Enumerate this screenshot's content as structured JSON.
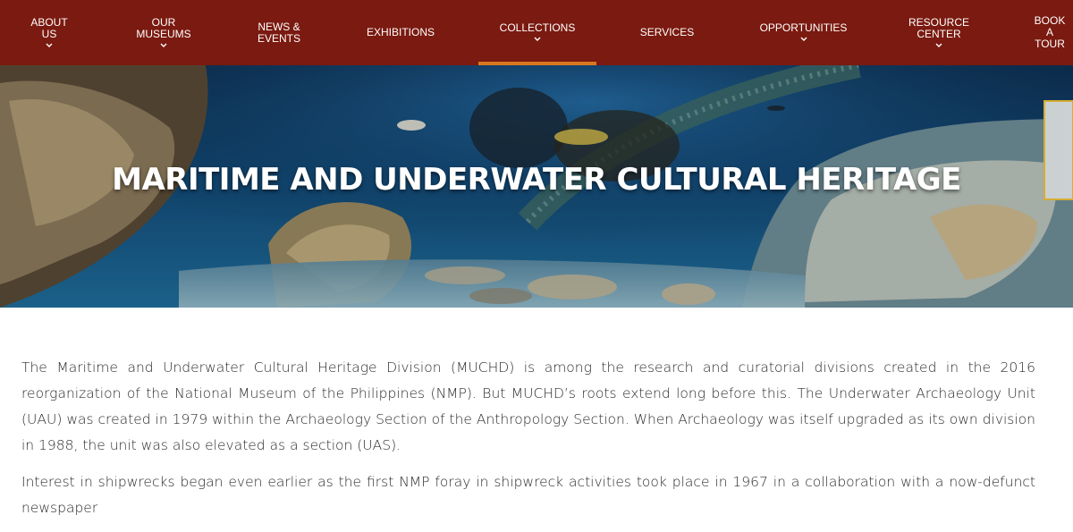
{
  "nav": {
    "items": [
      {
        "label": "ABOUT\nUS",
        "has_dropdown": true
      },
      {
        "label": "OUR\nMUSEUMS",
        "has_dropdown": true
      },
      {
        "label": "NEWS &\nEVENTS",
        "has_dropdown": false
      },
      {
        "label": "EXHIBITIONS",
        "has_dropdown": false
      },
      {
        "label": "COLLECTIONS",
        "has_dropdown": true,
        "active": true
      },
      {
        "label": "SERVICES",
        "has_dropdown": false
      },
      {
        "label": "OPPORTUNITIES",
        "has_dropdown": true
      },
      {
        "label": "RESOURCE\nCENTER",
        "has_dropdown": true
      },
      {
        "label": "BOOK\nA\nTOUR",
        "has_dropdown": false
      }
    ],
    "chevron_icon": "chevron-down-icon"
  },
  "hero": {
    "title": "MARITIME AND UNDERWATER CULTURAL HERITAGE",
    "image": "underwater-shipwreck-photo"
  },
  "content": {
    "paragraphs": [
      "The Maritime and Underwater Cultural Heritage Division (MUCHD) is among the research and curatorial divisions created in the 2016 reorganization of the National Museum of the Philippines (NMP). But MUCHD’s roots extend long before this. The Underwater Archaeology Unit (UAU) was created in 1979 within the Archaeology Section of the Anthropology Section. When Archaeology was itself upgraded as its own division in 1988, the unit was also elevated as a section (UAS).",
      "Interest in shipwrecks began even earlier as the first NMP foray in shipwreck activities took place in 1967 in a collaboration with a now-defunct newspaper"
    ]
  },
  "colors": {
    "nav_bg": "#7a1a10",
    "active_underline": "#d9771f",
    "text": "#2b2b2b"
  }
}
